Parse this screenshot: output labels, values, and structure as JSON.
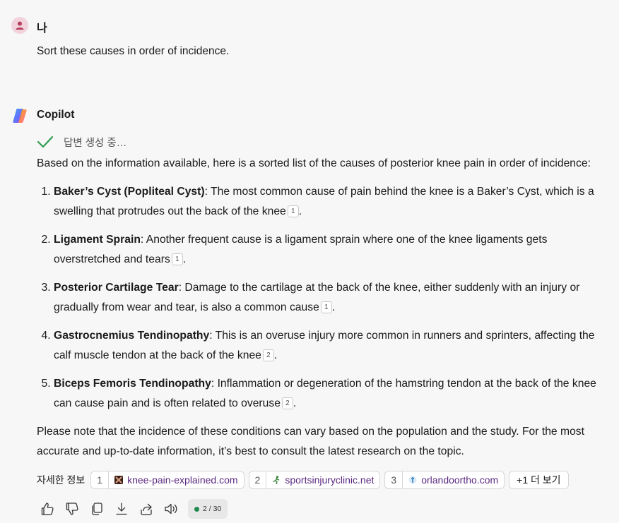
{
  "user": {
    "name": "나",
    "message": "Sort these causes in order of incidence."
  },
  "assistant": {
    "name": "Copilot",
    "status": "답변 생성 중…",
    "intro": "Based on the information available, here is a sorted list of the causes of posterior knee pain in order of incidence:",
    "items": [
      {
        "term": "Baker’s Cyst (Popliteal Cyst)",
        "text": ": The most common cause of pain behind the knee is a Baker’s Cyst, which is a swelling that protrudes out the back of the knee",
        "cite": "1"
      },
      {
        "term": "Ligament Sprain",
        "text": ": Another frequent cause is a ligament sprain where one of the knee ligaments gets overstretched and tears",
        "cite": "1"
      },
      {
        "term": "Posterior Cartilage Tear",
        "text": ": Damage to the cartilage at the back of the knee, either suddenly with an injury or gradually from wear and tear, is also a common cause",
        "cite": "1"
      },
      {
        "term": "Gastrocnemius Tendinopathy",
        "text": ": This is an overuse injury more common in runners and sprinters, affecting the calf muscle tendon at the back of the knee",
        "cite": "2"
      },
      {
        "term": "Biceps Femoris Tendinopathy",
        "text": ": Inflammation or degeneration of the hamstring tendon at the back of the knee can cause pain and is often related to overuse",
        "cite": "2"
      }
    ],
    "closing": "Please note that the incidence of these conditions can vary based on the population and the study. For the most accurate and up-to-date information, it’s best to consult the latest research on the topic."
  },
  "sources": {
    "label": "자세한 정보",
    "items": [
      {
        "num": "1",
        "site": "knee-pain-explained.com",
        "icon": "knee-favicon",
        "color": "#6b2f1f"
      },
      {
        "num": "2",
        "site": "sportsinjuryclinic.net",
        "icon": "runner-favicon",
        "color": "#2e7d32"
      },
      {
        "num": "3",
        "site": "orlandoortho.com",
        "icon": "ortho-favicon",
        "color": "#2a7bbf"
      }
    ],
    "more": "+1 더 보기"
  },
  "actions": {
    "pager": "2 / 30"
  },
  "colors": {
    "check": "#2e9c4f",
    "link": "#5b2a80",
    "pager_dot": "#1f8a4c"
  }
}
